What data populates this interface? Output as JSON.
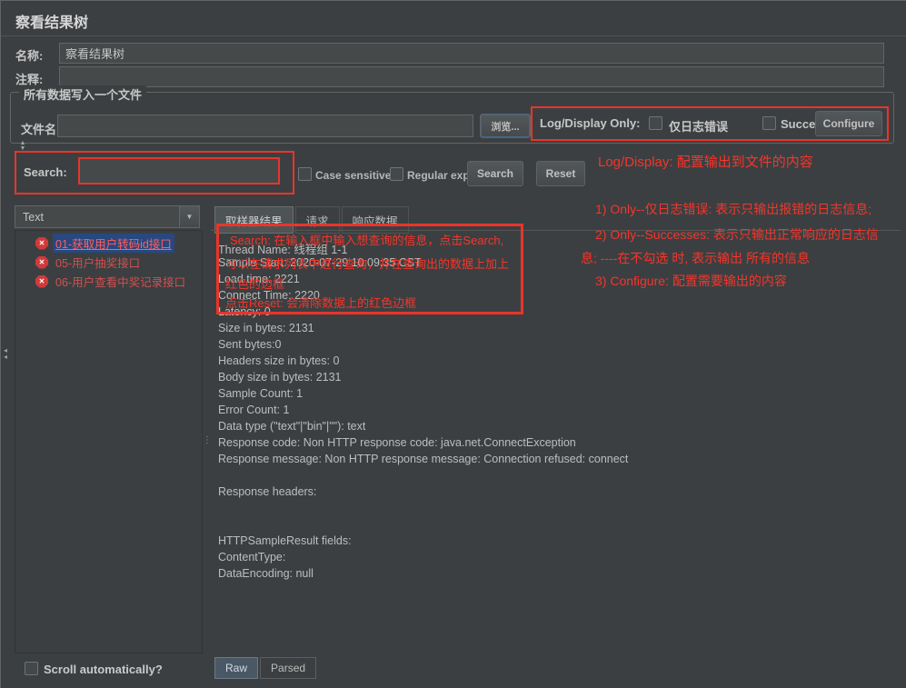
{
  "window": {
    "title": "察看结果树"
  },
  "fields": {
    "name_label": "名称:",
    "name_value": "察看结果树",
    "comment_label": "注释:",
    "comment_value": ""
  },
  "file_group": {
    "title": "所有数据写入一个文件",
    "filename_label": "文件名",
    "filename_value": "",
    "browse_button": "浏览...",
    "log_display_label": "Log/Display Only:",
    "errors_only_label": "仅日志错误",
    "successes_label": "Successes",
    "configure_button": "Configure"
  },
  "search_bar": {
    "label": "Search:",
    "input_value": "",
    "case_sensitive_label": "Case sensitive",
    "regular_exp_label": "Regular exp.",
    "search_button": "Search",
    "reset_button": "Reset"
  },
  "tree": {
    "filter_value": "Text",
    "items": [
      {
        "label": "01-获取用户转码id接口",
        "selected": true
      },
      {
        "label": "05-用户抽奖接口",
        "selected": false
      },
      {
        "label": "06-用户查看中奖记录接口",
        "selected": false
      }
    ],
    "scroll_label": "Scroll automatically?"
  },
  "result_panel": {
    "tabs": [
      {
        "label": "取样器结果"
      },
      {
        "label": "请求"
      },
      {
        "label": "响应数据"
      }
    ],
    "lines": [
      "Thread Name: 线程组 1-1",
      "Sample Start: 2020-07-29 10:09:35 CST",
      "Load time: 2221",
      "Connect Time: 2220",
      "Latency: 0",
      "Size in bytes: 2131",
      "Sent bytes:0",
      "Headers size in bytes: 0",
      "Body size in bytes: 2131",
      "Sample Count: 1",
      "Error Count: 1",
      "Data type (\"text\"|\"bin\"|\"\"): text",
      "Response code: Non HTTP response code: java.net.ConnectException",
      "Response message: Non HTTP response message: Connection refused: connect",
      "",
      "Response headers:",
      "",
      "",
      "HTTPSampleResult fields:",
      "ContentType: ",
      "DataEncoding: null"
    ],
    "bottom_tabs": [
      {
        "label": "Raw"
      },
      {
        "label": "Parsed"
      }
    ]
  },
  "annotations": {
    "accent_color": "#f5352a",
    "log_display_note": "Log/Display: 配置输出到文件的内容",
    "note_1": "1) Only--仅日志错误: 表示只输出报错的日志信息;",
    "note_2_line1": "2) Only--Successes: 表示只输出正常响应的日志信",
    "note_2_line2": "息; ----在不勾选 时, 表示输出 所有的信息",
    "note_3": "3) Configure: 配置需要输出的内容",
    "result_box_line1": "Search: 在输入框中输入想查询的信息，点击Search,",
    "result_box_line2": "可以在请求列表中进行查询，并在查询出的数据上加上",
    "result_box_line3": "红色的边框",
    "result_box_line4": "点击Reset: 会清除数据上的红色边框"
  }
}
